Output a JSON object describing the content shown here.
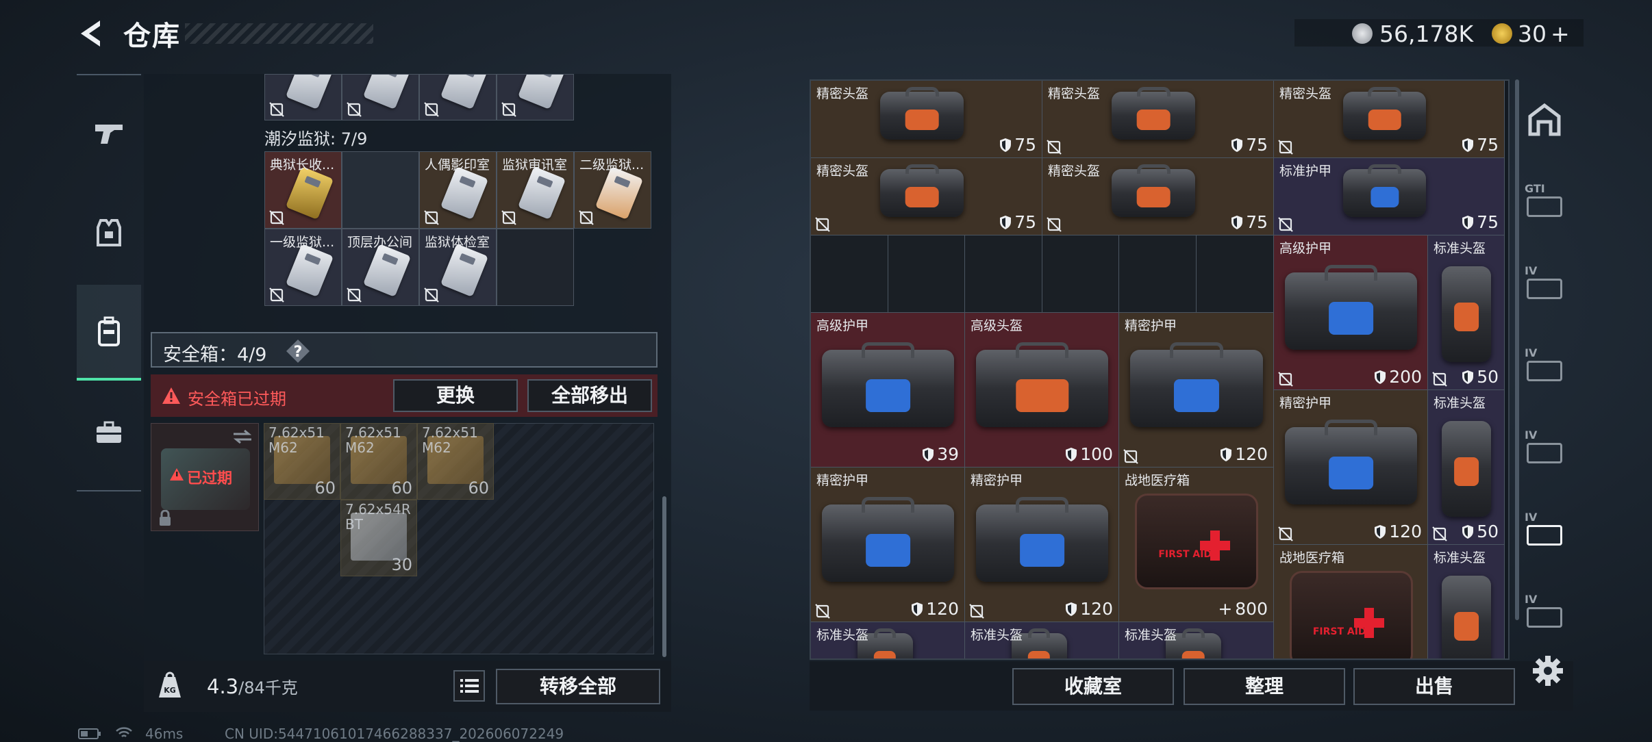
{
  "header": {
    "title": "仓库"
  },
  "currency": {
    "silver": "56,178K",
    "gold": "30",
    "gold_plus": "+"
  },
  "left_panel": {
    "prison_label": "潮汐监狱: 7/9",
    "key_cards": [
      {
        "label": "典狱长收...",
        "style": "gold",
        "card": "gold"
      },
      {
        "label": "",
        "style": "empty",
        "card": ""
      },
      {
        "label": "人偶影印室",
        "style": "brown",
        "card": "silver"
      },
      {
        "label": "监狱审讯室",
        "style": "brown",
        "card": "silver"
      },
      {
        "label": "二级监狱...",
        "style": "brown",
        "card": "orange"
      },
      {
        "label": "一级监狱...",
        "style": "key",
        "card": "silver"
      },
      {
        "label": "顶层办公间",
        "style": "key",
        "card": "silver"
      },
      {
        "label": "监狱体检室",
        "style": "key",
        "card": "silver"
      }
    ],
    "safe_box_label": "安全箱：4/9",
    "help_symbol": "?",
    "expired_warning": "安全箱已过期",
    "replace_button": "更换",
    "move_all_out_button": "全部移出",
    "expired_badge": "已过期",
    "ammo": [
      {
        "label": "7.62x51\nM62",
        "count": "60"
      },
      {
        "label": "7.62x51\nM62",
        "count": "60"
      },
      {
        "label": "7.62x51\nM62",
        "count": "60"
      },
      {
        "label": "7.62x54R\nBT",
        "count": "30"
      }
    ],
    "weight_value": "4.3",
    "weight_max": "/84千克",
    "weight_icon_text": "KG",
    "transfer_all_button": "转移全部"
  },
  "right_panel": {
    "items": [
      {
        "label": "精密头盔",
        "value": "75"
      },
      {
        "label": "精密头盔",
        "value": "75"
      },
      {
        "label": "精密头盔",
        "value": "75"
      },
      {
        "label": "精密头盔",
        "value": "75"
      },
      {
        "label": "精密头盔",
        "value": "75"
      },
      {
        "label": "标准护甲",
        "value": "75"
      },
      {
        "label": "高级护甲",
        "value": "200"
      },
      {
        "label": "标准头盔",
        "value": "50"
      },
      {
        "label": "高级护甲",
        "value": "39"
      },
      {
        "label": "高级头盔",
        "value": "100"
      },
      {
        "label": "精密护甲",
        "value": "120"
      },
      {
        "label": "精密护甲",
        "value": "120"
      },
      {
        "label": "标准头盔",
        "value": "50"
      },
      {
        "label": "精密护甲",
        "value": "120"
      },
      {
        "label": "精密护甲",
        "value": "120"
      },
      {
        "label": "战地医疗箱",
        "value": "800"
      },
      {
        "label": "战地医疗箱",
        "value": ""
      },
      {
        "label": "标准头盔",
        "value": ""
      },
      {
        "label": "标准头盔",
        "value": ""
      },
      {
        "label": "标准头盔",
        "value": ""
      },
      {
        "label": "标准头盔",
        "value": ""
      }
    ],
    "first_aid_text": "FIRST AID",
    "heal_symbol": "+",
    "collection_button": "收藏室",
    "sort_button": "整理",
    "sell_button": "出售",
    "rail_labels": [
      "GTI",
      "IV",
      "IV",
      "IV",
      "IV",
      "IV"
    ]
  },
  "status": {
    "ping": "46ms",
    "uid": "CN UID:54471061017466288337_202606072249"
  },
  "colors": {
    "accent": "#4fe3a8",
    "warning": "#ff5a5a",
    "gold": "#d4a42a"
  }
}
